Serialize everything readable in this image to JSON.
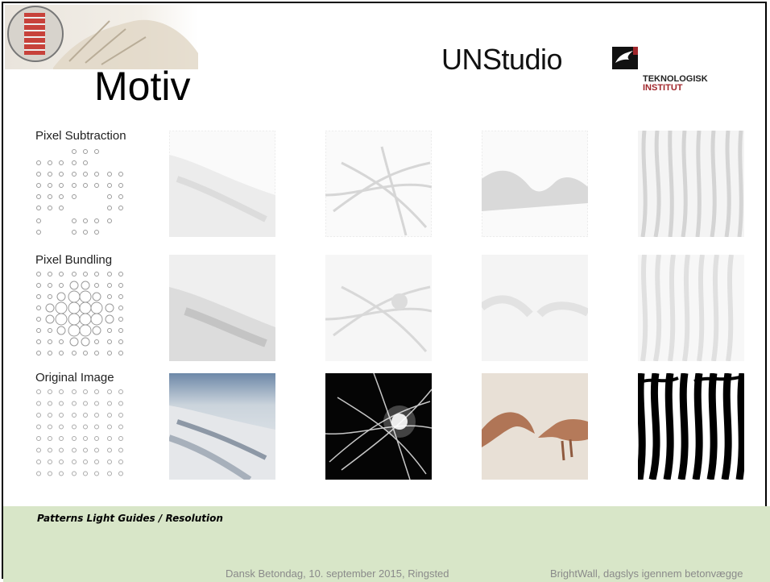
{
  "slide": {
    "title": "Motiv",
    "partner_logo_text": "UNStudio",
    "institute_logo": {
      "line1": "TEKNOLOGISK",
      "line2": "INSTITUT",
      "icon": "bird-icon",
      "accent_color": "#a0262b"
    },
    "rows": [
      {
        "label": "Pixel Subtraction"
      },
      {
        "label": "Pixel Bundling"
      },
      {
        "label": "Original Image"
      }
    ],
    "columns": [
      "clouds",
      "light-streaks",
      "creation-of-adam-hands",
      "zebra-stripes"
    ],
    "footer": {
      "caption": "Patterns Light Guides / Resolution",
      "left": "Dansk Betondag, 10. september 2015, Ringsted",
      "right": "BrightWall, dagslys igennem betonvægge",
      "band_color": "#d8e6c8"
    }
  }
}
